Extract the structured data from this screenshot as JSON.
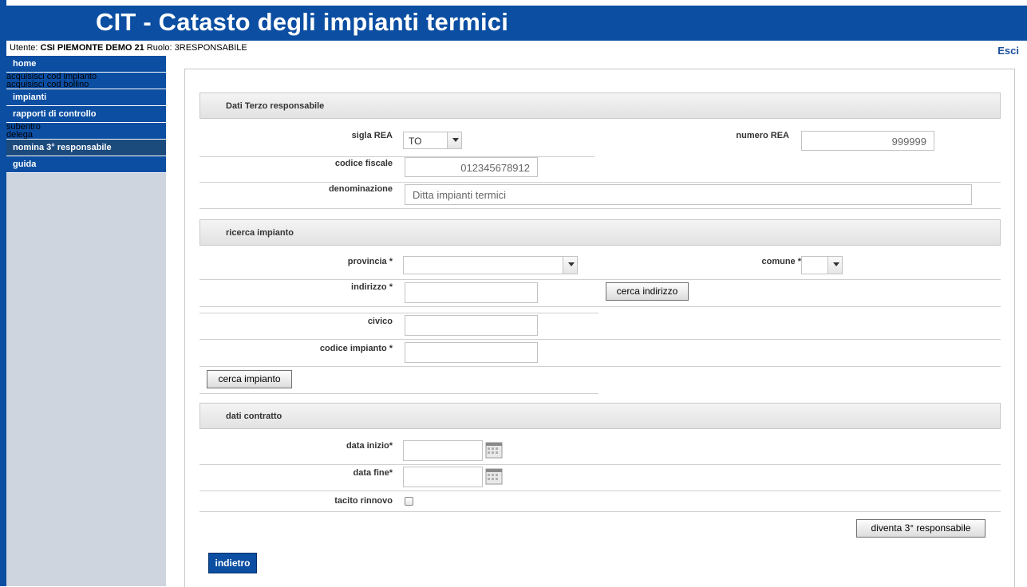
{
  "app": {
    "title": "CIT - Catasto degli impianti termici"
  },
  "user": {
    "prefix": "Utente:",
    "name": "CSI PIEMONTE DEMO 21",
    "role_prefix": "Ruolo:",
    "role": "3RESPONSABILE",
    "logout": "Esci"
  },
  "sidebar": {
    "home": "home",
    "acquisisci_impianto": "acquisisci cod impianto",
    "acquisisci_bollino": "acquisisci cod bollino",
    "impianti": "impianti",
    "rapporti": "rapporti di controllo",
    "subentro": "subentro",
    "delega": "delega",
    "nomina": "nomina 3° responsabile",
    "guida": "guida"
  },
  "terzo": {
    "section": "Dati Terzo responsabile",
    "sigla_rea_label": "sigla REA",
    "sigla_rea_value": "TO",
    "numero_rea_label": "numero REA",
    "numero_rea_value": "999999",
    "cf_label": "codice fiscale",
    "cf_value": "012345678912",
    "denominazione_label": "denominazione",
    "denominazione_value": "Ditta impianti termici"
  },
  "ricerca": {
    "section": "ricerca impianto",
    "provincia_label": "provincia *",
    "comune_label": "comune *",
    "indirizzo_label": "indirizzo *",
    "cerca_indirizzo": "cerca indirizzo",
    "civico_label": "civico",
    "codice_label": "codice impianto *",
    "cerca_impianto": "cerca impianto"
  },
  "contratto": {
    "section": "dati contratto",
    "data_inizio_label": "data inizio*",
    "data_fine_label": "data fine*",
    "tacito_label": "tacito rinnovo",
    "diventa": "diventa 3° responsabile"
  },
  "footer": {
    "indietro": "indietro"
  }
}
